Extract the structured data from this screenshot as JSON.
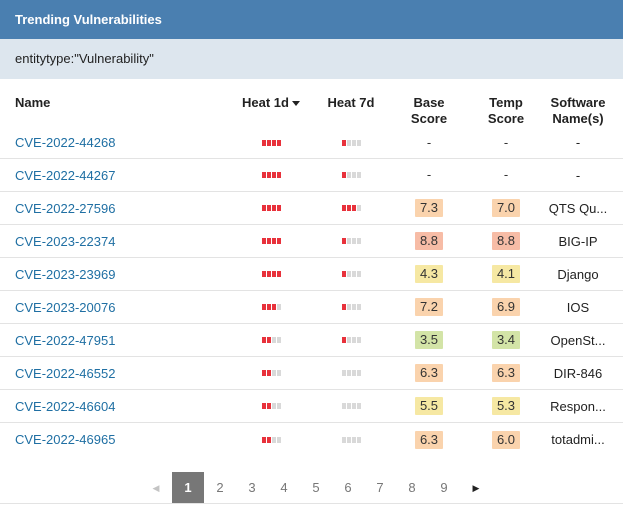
{
  "panel": {
    "title": "Trending Vulnerabilities",
    "query": "entitytype:\"Vulnerability\""
  },
  "colors": {
    "header_bg": "#4a7fb0",
    "query_bg": "#dde6ee",
    "link": "#1f6fa3",
    "heat_on": "#e8313b",
    "heat_off": "#d9d9d9",
    "score_high": "#f7bca6",
    "score_med": "#fad3ad",
    "score_mid": "#f6e8a3",
    "score_low": "#d3e4a7"
  },
  "columns": {
    "name": "Name",
    "heat_1d": "Heat 1d",
    "heat_7d": "Heat 7d",
    "base_score_1": "Base",
    "base_score_2": "Score",
    "temp_score_1": "Temp",
    "temp_score_2": "Score",
    "software_1": "Software",
    "software_2": "Name(s)",
    "sort_icon": "caret-down-icon"
  },
  "rows": [
    {
      "name": "CVE-2022-44268",
      "heat_1d": 4,
      "heat_7d": 1,
      "base": "-",
      "temp": "-",
      "software": "-",
      "base_color": "",
      "temp_color": ""
    },
    {
      "name": "CVE-2022-44267",
      "heat_1d": 4,
      "heat_7d": 1,
      "base": "-",
      "temp": "-",
      "software": "-",
      "base_color": "",
      "temp_color": ""
    },
    {
      "name": "CVE-2022-27596",
      "heat_1d": 4,
      "heat_7d": 3,
      "base": "7.3",
      "temp": "7.0",
      "software": "QTS Qu...",
      "base_color": "#fad3ad",
      "temp_color": "#fad3ad"
    },
    {
      "name": "CVE-2023-22374",
      "heat_1d": 4,
      "heat_7d": 1,
      "base": "8.8",
      "temp": "8.8",
      "software": "BIG-IP",
      "base_color": "#f7bca6",
      "temp_color": "#f7bca6"
    },
    {
      "name": "CVE-2023-23969",
      "heat_1d": 4,
      "heat_7d": 1,
      "base": "4.3",
      "temp": "4.1",
      "software": "Django",
      "base_color": "#f6e8a3",
      "temp_color": "#f6e8a3"
    },
    {
      "name": "CVE-2023-20076",
      "heat_1d": 3,
      "heat_7d": 1,
      "base": "7.2",
      "temp": "6.9",
      "software": "IOS",
      "base_color": "#fad3ad",
      "temp_color": "#fad3ad"
    },
    {
      "name": "CVE-2022-47951",
      "heat_1d": 2,
      "heat_7d": 1,
      "base": "3.5",
      "temp": "3.4",
      "software": "OpenSt...",
      "base_color": "#d3e4a7",
      "temp_color": "#d3e4a7"
    },
    {
      "name": "CVE-2022-46552",
      "heat_1d": 2,
      "heat_7d": 0,
      "base": "6.3",
      "temp": "6.3",
      "software": "DIR-846",
      "base_color": "#fad3ad",
      "temp_color": "#fad3ad"
    },
    {
      "name": "CVE-2022-46604",
      "heat_1d": 2,
      "heat_7d": 0,
      "base": "5.5",
      "temp": "5.3",
      "software": "Respon...",
      "base_color": "#f6e8a3",
      "temp_color": "#f6e8a3"
    },
    {
      "name": "CVE-2022-46965",
      "heat_1d": 2,
      "heat_7d": 0,
      "base": "6.3",
      "temp": "6.0",
      "software": "totadmi...",
      "base_color": "#fad3ad",
      "temp_color": "#fad3ad"
    }
  ],
  "pagination": {
    "prev_icon": "chevron-left-icon",
    "next_icon": "chevron-right-icon",
    "prev_glyph": "◀",
    "next_glyph": "▶",
    "current": 1,
    "pages": [
      "1",
      "2",
      "3",
      "4",
      "5",
      "6",
      "7",
      "8",
      "9"
    ]
  }
}
